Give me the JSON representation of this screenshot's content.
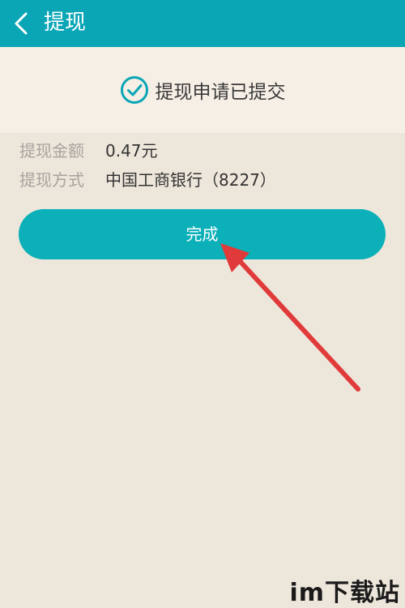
{
  "header": {
    "title": "提现",
    "back_icon": "chevron-left-icon"
  },
  "status": {
    "icon": "check-circle-icon",
    "text": "提现申请已提交"
  },
  "details": [
    {
      "label": "提现金额",
      "value": "0.47元"
    },
    {
      "label": "提现方式",
      "value": "中国工商银行（8227）"
    }
  ],
  "done_button": {
    "label": "完成"
  },
  "annotation": {
    "arrow_color": "#e03a3a"
  },
  "watermark": {
    "text": "im下载站"
  },
  "colors": {
    "header": "#0aa6b6",
    "button": "#0bb0b8",
    "background": "#ede6db"
  }
}
